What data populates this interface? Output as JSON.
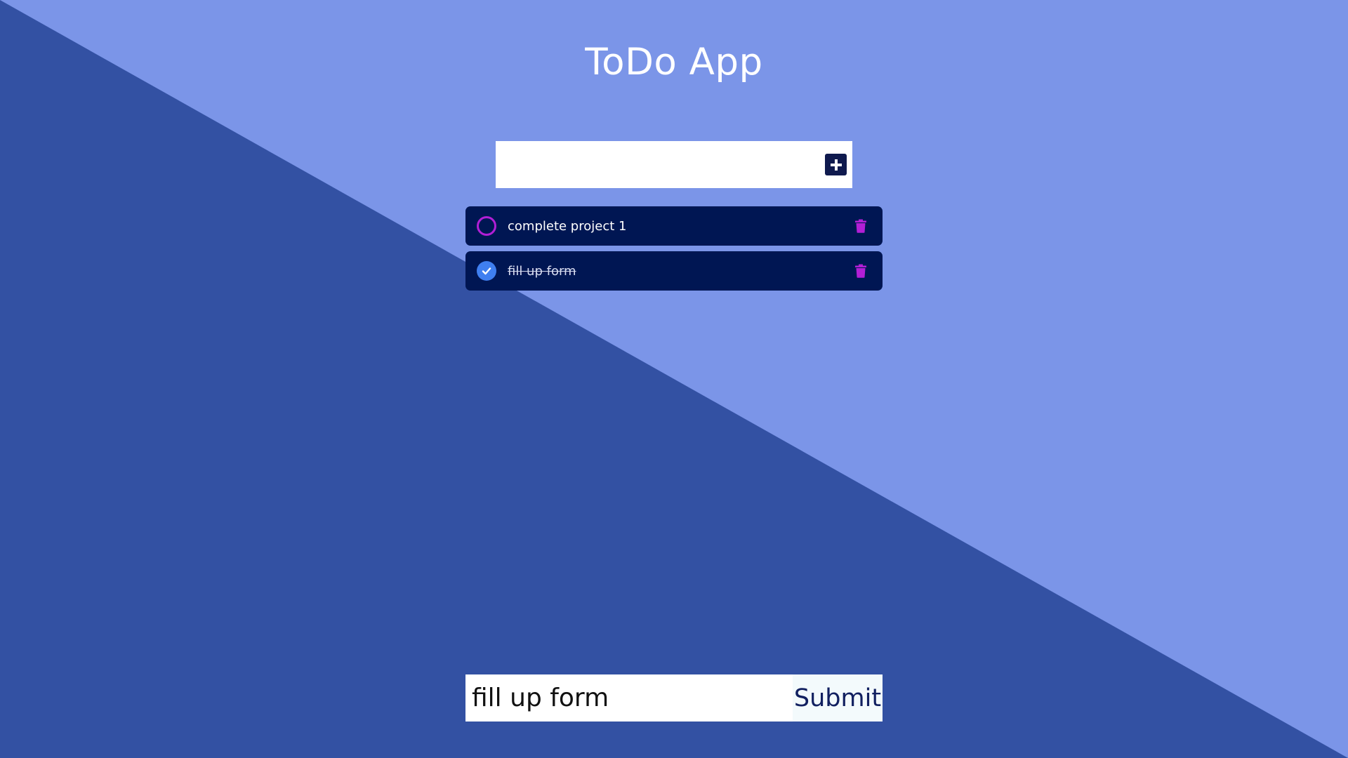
{
  "app": {
    "title": "ToDo App",
    "colors": {
      "bg_light": "#7b95e8",
      "bg_dark": "#3351a3",
      "item_bg": "#001653",
      "accent_purple": "#b21fd6",
      "accent_blue": "#3f7ff0"
    }
  },
  "add_form": {
    "input_value": "",
    "button_icon": "plus-square-icon"
  },
  "todos": [
    {
      "text": "complete project 1",
      "completed": false,
      "check_icon": "circle-icon",
      "delete_icon": "trash-icon"
    },
    {
      "text": "fill up form",
      "completed": true,
      "check_icon": "check-circle-icon",
      "delete_icon": "trash-icon"
    }
  ],
  "bottom_form": {
    "input_value": "fill up form",
    "submit_label": "Submit"
  }
}
